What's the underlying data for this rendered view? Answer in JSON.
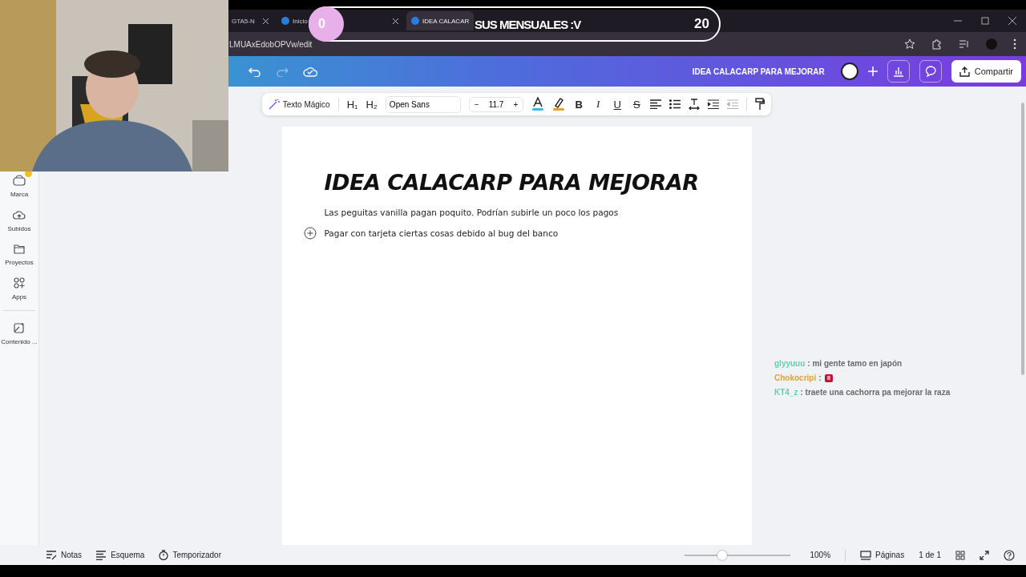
{
  "browser": {
    "tabs": [
      {
        "label": "GTA5-N",
        "selected": false
      },
      {
        "label": "Inicio",
        "selected": false
      },
      {
        "label": "IDEA CALACAR",
        "selected": true
      }
    ],
    "address": "LMUAxEdobOPVw/edit"
  },
  "header": {
    "document_title": "IDEA CALACARP PARA MEJORAR",
    "share_button": "Compartir"
  },
  "toolbar": {
    "magic_text": "Texto Mágico",
    "h1": "H₁",
    "h2": "H₂",
    "font": "Open Sans",
    "font_size": "11.7",
    "minus": "−",
    "plus": "+",
    "bold": "B",
    "italic": "I",
    "underline": "U",
    "strike": "S"
  },
  "sidebar": {
    "items": [
      {
        "label": "Marca",
        "badge": true
      },
      {
        "label": "Subidos",
        "badge": false
      },
      {
        "label": "Proyectos",
        "badge": false
      },
      {
        "label": "Apps",
        "badge": false
      },
      {
        "label": "Contenido ...",
        "badge": false
      }
    ]
  },
  "document": {
    "title": "IDEA CALACARP PARA MEJORAR",
    "paragraphs": [
      "Las peguitas vanilla pagan poquito. Podrían subirle un poco los pagos",
      "Pagar con tarjeta ciertas cosas debido al bug del banco"
    ]
  },
  "footer": {
    "left": [
      {
        "label": "Notas"
      },
      {
        "label": "Esquema"
      },
      {
        "label": "Temporizador"
      }
    ],
    "zoom": {
      "level": 0.32,
      "reading": "100%"
    },
    "pages": "Páginas",
    "page_count": "1 de 1"
  },
  "stream_goal": {
    "title": "SUS MENSUALES :V",
    "current": "0",
    "target": "20"
  },
  "chat": [
    {
      "user": "glyyuuu",
      "color": "#5fd0b0",
      "kind": "text",
      "message": ": mi gente tamo en japón"
    },
    {
      "user": "Chokocripi",
      "color": "#e0a040",
      "kind": "emote",
      "message": ":"
    },
    {
      "user": "KT4_z",
      "color": "#5fd0b0",
      "kind": "text",
      "message": ": traete una cachorra pa mejorar la raza"
    }
  ]
}
